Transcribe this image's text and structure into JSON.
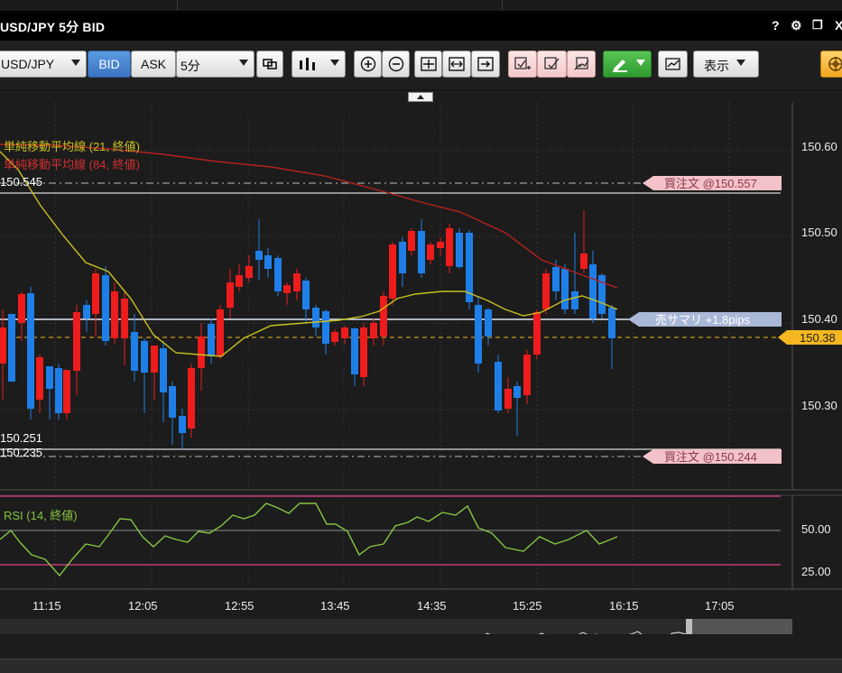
{
  "window": {
    "title": "USD/JPY 5分 BID",
    "controls": {
      "help": "?",
      "settings": "⚙",
      "restore": "❐",
      "close": "X"
    }
  },
  "toolbar": {
    "symbol": "USD/JPY",
    "bid_label": "BID",
    "ask_label": "ASK",
    "timeframe": "5分",
    "display_label": "表示"
  },
  "chart": {
    "legend": {
      "sma21": "単純移動平均線 (21, 終値)",
      "sma84": "単純移動平均線 (84, 終値)",
      "rsi": "RSI (14, 終値)"
    },
    "price_labels": {
      "high": "150.545",
      "low1": "150.251",
      "low2": "150.235"
    },
    "tags": {
      "buy_order_high": "買注文 @150.557",
      "sell_summary": "売サマリ +1.8pips",
      "current_price": "150.38",
      "buy_order_low": "買注文 @150.244"
    },
    "price_axis": [
      "150.60",
      "150.50",
      "150.40",
      "150.30"
    ],
    "rsi_axis": [
      "50.00",
      "25.00"
    ],
    "time_axis": [
      "11:15",
      "12:05",
      "12:55",
      "13:45",
      "14:35",
      "15:25",
      "16:15",
      "17:05"
    ]
  },
  "colors": {
    "up_candle": "#ee1c1c",
    "down_candle": "#1e7fe8",
    "sma21": "#c8c020",
    "sma84": "#b82020",
    "rsi": "#86c440",
    "current_price": "#f5b820"
  }
}
